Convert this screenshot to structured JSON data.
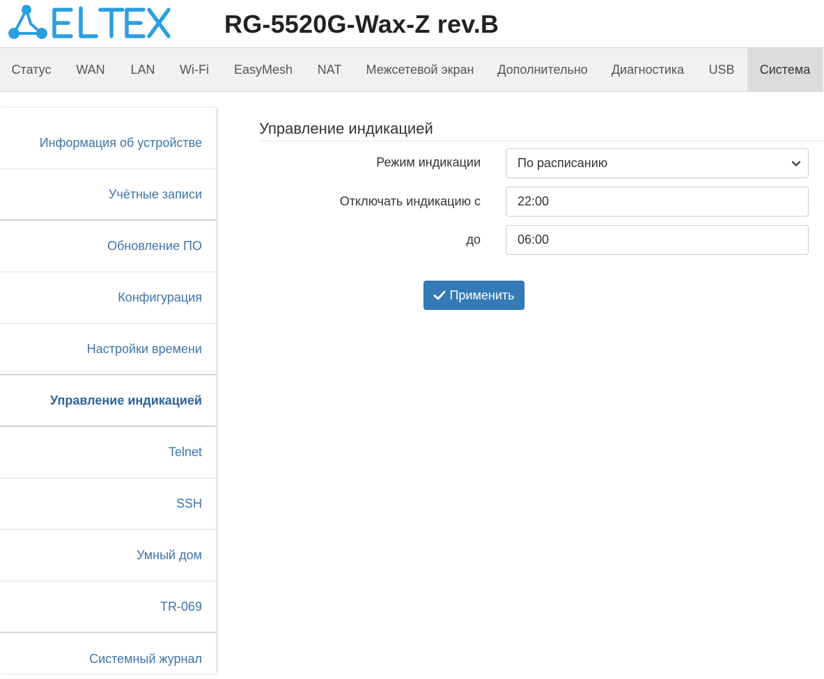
{
  "header": {
    "logo_text": "ELTEX",
    "device_title": "RG-5520G-Wax-Z rev.B"
  },
  "colors": {
    "accent": "#337ab7",
    "logo": "#2a9fe0",
    "link": "#3c74ad"
  },
  "nav": {
    "items": [
      {
        "label": "Статус"
      },
      {
        "label": "WAN"
      },
      {
        "label": "LAN"
      },
      {
        "label": "Wi-Fi"
      },
      {
        "label": "EasyMesh"
      },
      {
        "label": "NAT"
      },
      {
        "label": "Межсетевой экран"
      },
      {
        "label": "Дополнительно"
      },
      {
        "label": "Диагностика"
      },
      {
        "label": "USB"
      },
      {
        "label": "Система",
        "active": true
      }
    ]
  },
  "sidebar": {
    "items": [
      {
        "label": "Информация об устройстве"
      },
      {
        "label": "Учётные записи"
      },
      {
        "label": "Обновление ПО"
      },
      {
        "label": "Конфигурация"
      },
      {
        "label": "Настройки времени"
      },
      {
        "label": "Управление индикацией",
        "active": true
      },
      {
        "label": "Telnet"
      },
      {
        "label": "SSH"
      },
      {
        "label": "Умный дом"
      },
      {
        "label": "TR-069"
      },
      {
        "label": "Системный журнал"
      }
    ]
  },
  "main": {
    "title": "Управление индикацией",
    "mode": {
      "label": "Режим индикации",
      "value": "По расписанию"
    },
    "off_from": {
      "label": "Отключать индикацию с",
      "value": "22:00"
    },
    "off_to": {
      "label": "до",
      "value": "06:00"
    },
    "apply_label": "Применить"
  },
  "icons": {
    "select_arrow": "chevron-down-icon",
    "apply": "check-icon"
  }
}
